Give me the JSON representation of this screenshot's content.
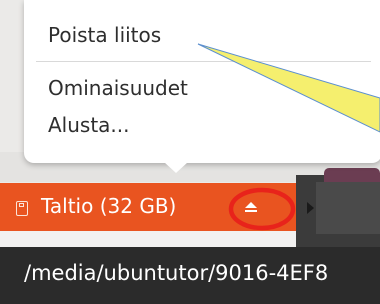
{
  "context_menu": {
    "items": [
      {
        "label": "Poista liitos"
      },
      {
        "label": "Ominaisuudet"
      },
      {
        "label": "Alusta..."
      }
    ]
  },
  "device_bar": {
    "label": "Taltio (32 GB)",
    "icon": "drive-icon",
    "eject_icon": "eject-icon",
    "color": "#e95420"
  },
  "path_tooltip": {
    "text": "/media/ubuntutor/9016-4EF8"
  },
  "annotations": {
    "highlight_color": "#e8231b",
    "pointer_color": "#f5ef6e"
  }
}
